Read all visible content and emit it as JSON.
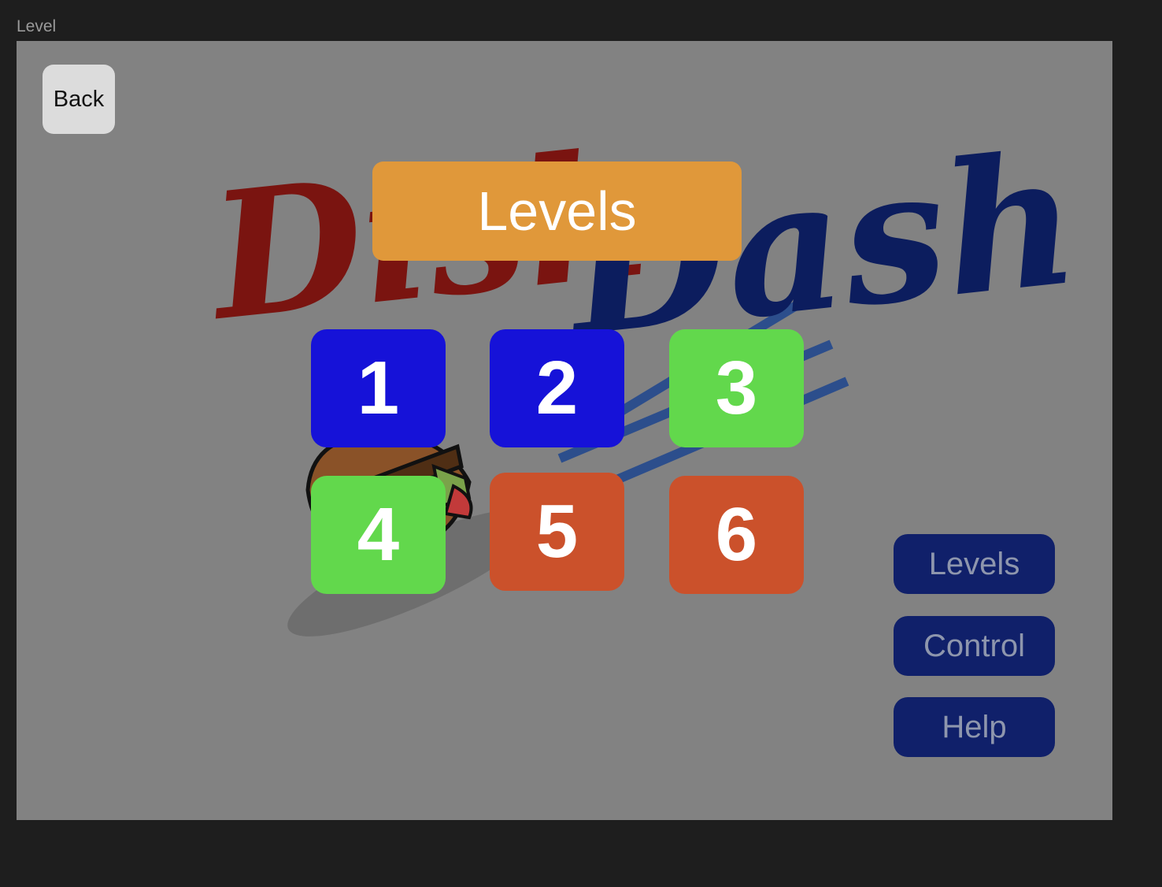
{
  "window": {
    "frame_label": "Level"
  },
  "header": {
    "back_label": "Back",
    "banner_title": "Levels"
  },
  "logo": {
    "word_left": "Dish",
    "word_right": "Dash"
  },
  "levels": [
    {
      "label": "1",
      "color": "#1612d8"
    },
    {
      "label": "2",
      "color": "#1612d8"
    },
    {
      "label": "3",
      "color": "#62d84c"
    },
    {
      "label": "4",
      "color": "#62d84c"
    },
    {
      "label": "5",
      "color": "#cb512b"
    },
    {
      "label": "6",
      "color": "#cb512b"
    }
  ],
  "menu": {
    "levels_label": "Levels",
    "control_label": "Control",
    "help_label": "Help"
  },
  "colors": {
    "canvas_bg": "#828282",
    "banner": "#e0983a",
    "menu_button": "#10206a",
    "logo_red": "#7a1410",
    "logo_navy": "#0c1d5e",
    "speed_lines": "#2c4e8c"
  }
}
